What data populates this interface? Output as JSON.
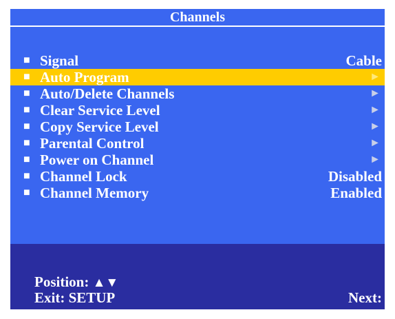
{
  "title": "Channels",
  "menu": {
    "bullet": "■",
    "items": [
      {
        "label": "Signal",
        "value": "Cable",
        "arrow": ""
      },
      {
        "label": "Auto Program",
        "value": "",
        "arrow": "►"
      },
      {
        "label": "Auto/Delete Channels",
        "value": "",
        "arrow": "►"
      },
      {
        "label": "Clear Service Level",
        "value": "",
        "arrow": "►"
      },
      {
        "label": "Copy Service Level",
        "value": "",
        "arrow": "►"
      },
      {
        "label": "Parental Control",
        "value": "",
        "arrow": "►"
      },
      {
        "label": "Power on Channel",
        "value": "",
        "arrow": "►"
      },
      {
        "label": "Channel Lock",
        "value": "Disabled",
        "arrow": ""
      },
      {
        "label": "Channel Memory",
        "value": "Enabled",
        "arrow": ""
      }
    ],
    "selected_index": 1
  },
  "footer": {
    "position_label": "Position:",
    "up_glyph": "▲",
    "down_glyph": "▼",
    "exit_label": "Exit: SETUP",
    "next_label": "Next:"
  },
  "colors": {
    "menu_background": "#3a66f0",
    "footer_background": "#2a2da0",
    "highlight": "#ffcc00",
    "text": "#ffffff"
  }
}
